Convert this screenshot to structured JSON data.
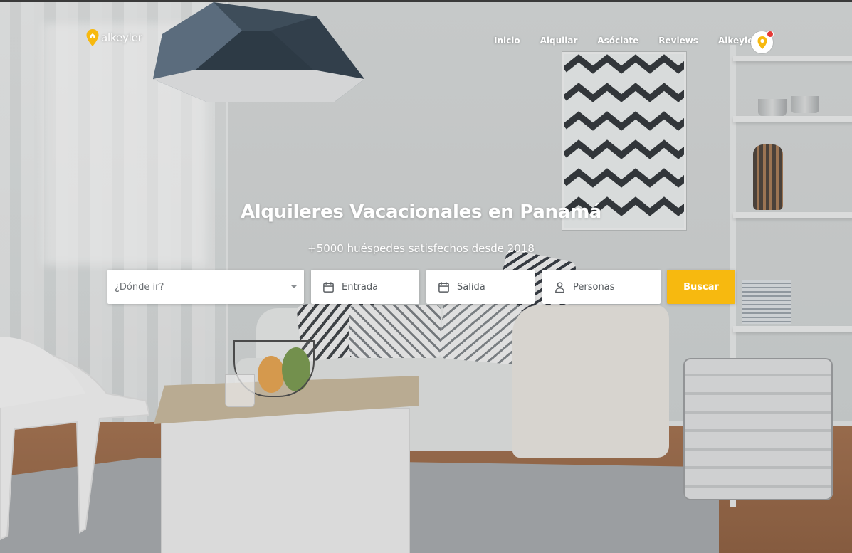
{
  "brand": {
    "name": "alkeyler",
    "accent_color": "#f7b90f",
    "logo_icon": "location-pin-home-icon"
  },
  "nav": {
    "items": [
      {
        "label": "Inicio"
      },
      {
        "label": "Alquilar"
      },
      {
        "label": "Asóciate"
      },
      {
        "label": "Reviews"
      },
      {
        "label": "Alkeyler"
      }
    ],
    "avatar_icon": "location-pin-icon",
    "notification_color": "#e53935"
  },
  "hero": {
    "title": "Alquileres Vacacionales en Panamá",
    "subtitle": "+5000 huéspedes satisfechos desde 2018"
  },
  "search": {
    "destination_placeholder": "¿Dónde ir?",
    "checkin_placeholder": "Entrada",
    "checkout_placeholder": "Salida",
    "guests_placeholder": "Personas",
    "button_label": "Buscar",
    "calendar_icon": "calendar-icon",
    "guests_icon": "person-icon",
    "dropdown_icon": "chevron-down-icon"
  }
}
